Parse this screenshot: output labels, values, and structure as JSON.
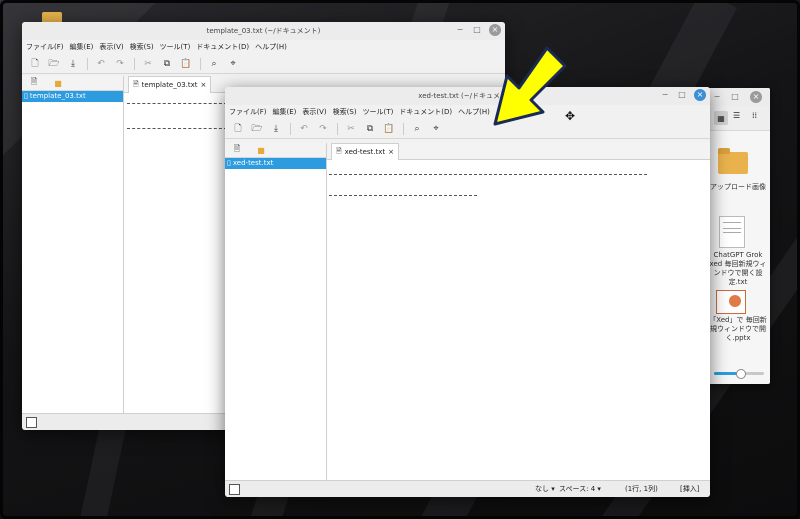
{
  "window1": {
    "title": "template_03.txt (~/ドキュメント)",
    "menu": [
      "ファイル(F)",
      "編集(E)",
      "表示(V)",
      "検索(S)",
      "ツール(T)",
      "ドキュメント(D)",
      "ヘルプ(H)"
    ],
    "file_item": "template_03.txt",
    "tab_label": "template_03.txt",
    "tab_close": "×"
  },
  "window2": {
    "title": "xed-test.txt (~/ドキュメント)",
    "menu": [
      "ファイル(F)",
      "編集(E)",
      "表示(V)",
      "検索(S)",
      "ツール(T)",
      "ドキュメント(D)",
      "ヘルプ(H)"
    ],
    "file_item": "xed-test.txt",
    "tab_label": "xed-test.txt",
    "tab_close": "×",
    "status": {
      "syntax": "なし ▾",
      "spaces": "スペース: 4 ▾",
      "position": "(1行, 1列)",
      "mode": "[挿入]"
    }
  },
  "window_controls": {
    "minimize": "−",
    "maximize": "□",
    "close": "×"
  },
  "file_manager": {
    "items": [
      {
        "label": "アップロード画像",
        "icon": "folder-icon"
      },
      {
        "label": "ChatGPT Grok xed 毎回新規ウィンドウで開く設定.txt",
        "icon": "text-file-icon"
      },
      {
        "label": "「Xed」で 毎回新規ウィンドウで開く.pptx",
        "icon": "pptx-file-icon"
      }
    ]
  },
  "colors": {
    "accent": "#2c9be0",
    "arrow_fill": "#ffff00",
    "arrow_outline": "#1a2a55"
  }
}
